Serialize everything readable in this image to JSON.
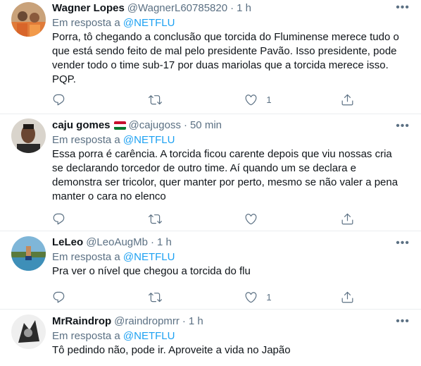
{
  "reply_label": "Em resposta a",
  "tweets": [
    {
      "name": "Wagner Lopes",
      "handle": "@WagnerL60785820",
      "dot": "·",
      "time": "1 h",
      "reply_to": "@NETFLU",
      "text": "Porra, tô chegando a conclusão que torcida do Fluminense merece tudo o que está sendo feito de mal pelo presidente Pavão. Isso presidente, pode vender todo o time sub-17 por duas mariolas que a torcida merece isso. PQP.",
      "reply_count": "",
      "retweet_count": "",
      "like_count": "1"
    },
    {
      "name": "caju gomes",
      "handle": "@cajugoss",
      "dot": "·",
      "time": "50 min",
      "reply_to": "@NETFLU",
      "text": "Essa porra é carência. A torcida ficou carente depois que viu nossas cria se declarando torcedor de outro time. Aí quando um se declara e demonstra ser tricolor, quer manter por perto, mesmo se não valer a pena manter o cara no elenco",
      "reply_count": "",
      "retweet_count": "",
      "like_count": ""
    },
    {
      "name": "LeLeo",
      "handle": "@LeoAugMb",
      "dot": "·",
      "time": "1 h",
      "reply_to": "@NETFLU",
      "text": "Pra ver o nível que chegou a torcida do flu",
      "reply_count": "",
      "retweet_count": "",
      "like_count": "1"
    },
    {
      "name": "MrRaindrop",
      "handle": "@raindropmrr",
      "dot": "·",
      "time": "1 h",
      "reply_to": "@NETFLU",
      "text": "Tô pedindo não, pode ir. Aproveite a vida no Japão"
    }
  ],
  "flag_colors": [
    "#c8102e",
    "#ffffff",
    "#0a7a2f"
  ],
  "colors": {
    "secondary": "#5b7083",
    "accent": "#1da1f2",
    "divider": "#ebeef0"
  }
}
